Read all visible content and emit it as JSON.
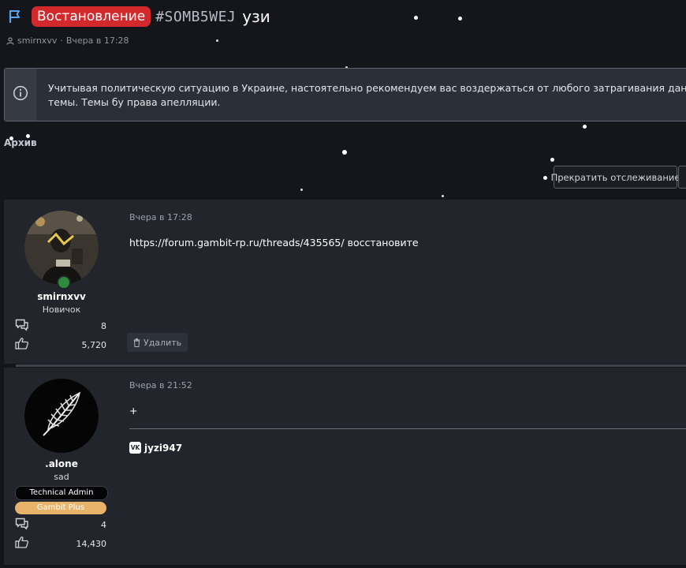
{
  "header": {
    "prefix": "Востановление",
    "code": "#SOMB5WEJ",
    "name": "узи",
    "author": "smirnxvv",
    "separator": "·",
    "date": "Вчера в 17:28"
  },
  "notice": {
    "text": "Учитывая политическую ситуацию в Украине, настоятельно рекомендуем вас воздержаться от любого затрагивания данной темы. Темы бу права апелляции."
  },
  "archive_label": "Архив",
  "actions": {
    "unfollow": "Прекратить отслеживание"
  },
  "posts": [
    {
      "username": "smirnxvv",
      "usertitle": "Новичок",
      "messages": "8",
      "reactions": "5,720",
      "date": "Вчера в 17:28",
      "body": "https://forum.gambit-rp.ru/threads/435565/ восстановите",
      "delete_label": "Удалить"
    },
    {
      "username": ".alone",
      "usertitle": "sad",
      "banners": [
        "Technical Admin",
        "Gambit Plus"
      ],
      "messages": "4",
      "reactions": "14,430",
      "date": "Вчера в 21:52",
      "body": "+",
      "signature": "jyzi947",
      "signature_icon_text": "VK"
    }
  ],
  "colors": {
    "background": "#14161b",
    "prefix_badge": "#d3292d",
    "post_bg": "#22252c",
    "notice_bg": "#2b2f37",
    "online": "#2e8b3e",
    "banner_admin": "#050507",
    "banner_plus": "#e8b46a"
  },
  "icons": [
    "flag-icon",
    "user-icon",
    "info-icon",
    "comments-icon",
    "thumbs-up-icon",
    "trash-icon",
    "vk-icon"
  ]
}
